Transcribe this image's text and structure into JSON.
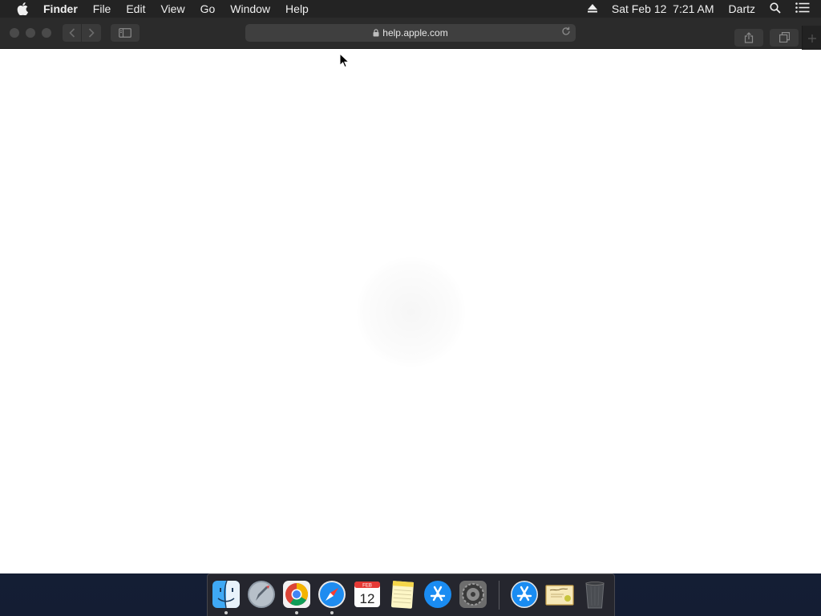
{
  "menubar": {
    "app_name": "Finder",
    "menus": [
      "File",
      "Edit",
      "View",
      "Go",
      "Window",
      "Help"
    ],
    "datetime": "Sat Feb 12  7:21 AM",
    "user": "Dartz"
  },
  "browser": {
    "url": "help.apple.com"
  },
  "dock": {
    "items": [
      {
        "name": "Finder",
        "icon": "finder-icon",
        "running": true
      },
      {
        "name": "Launchpad",
        "icon": "launchpad-icon",
        "running": false
      },
      {
        "name": "Google Chrome",
        "icon": "chrome-icon",
        "running": true
      },
      {
        "name": "Safari",
        "icon": "safari-icon",
        "running": true
      },
      {
        "name": "Calendar",
        "icon": "calendar-icon",
        "running": false,
        "month": "FEB",
        "day": "12"
      },
      {
        "name": "Notes",
        "icon": "notes-icon",
        "running": false
      },
      {
        "name": "App Store",
        "icon": "app-store-icon",
        "running": false
      },
      {
        "name": "System Preferences",
        "icon": "system-preferences-icon",
        "running": false
      },
      {
        "name": "App Store Download",
        "icon": "app-store-stack-icon",
        "running": false
      },
      {
        "name": "Certificate",
        "icon": "certificate-icon",
        "running": false
      },
      {
        "name": "Trash",
        "icon": "trash-icon",
        "running": false
      }
    ]
  },
  "colors": {
    "menubar_bg": "#232323",
    "toolbar_bg": "#2b2b2b",
    "desktop_bg": "#1b2742"
  }
}
